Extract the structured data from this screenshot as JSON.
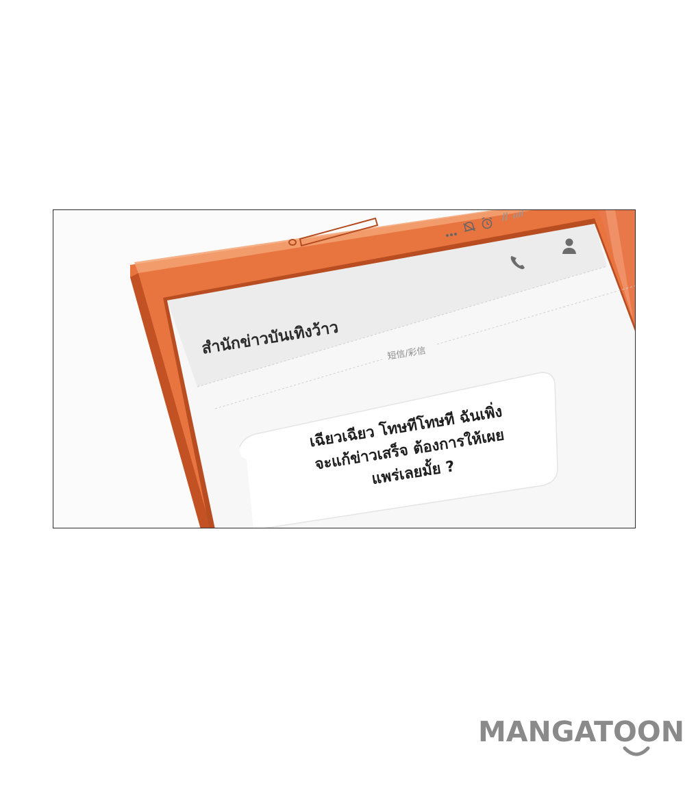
{
  "conversation": {
    "contact_name": "สำนักข่าวบันเทิงว้าว",
    "channel_label": "短信/彩信",
    "message_lines": [
      "เฉียวเฉียว โทษทีโทษที ฉันเพิ่ง",
      "จะแก้ข่าวเสร็จ ต้องการให้เผย",
      "แพร่เลยมั้ย ?"
    ]
  },
  "watermark": {
    "text": "MANGATOON"
  },
  "colors": {
    "phone_body": "#e8743f",
    "phone_body_dark": "#c9552a",
    "screen_bg": "#f7f7f7",
    "header_bg": "#ececec",
    "bubble_bg": "#ffffff",
    "watermark": "#8a8a8a"
  },
  "icons": {
    "status_bar": [
      "dots-icon",
      "vibrate-icon",
      "alarm-icon",
      "signal-icon"
    ],
    "header": [
      "phone-icon",
      "contact-person-icon"
    ]
  }
}
